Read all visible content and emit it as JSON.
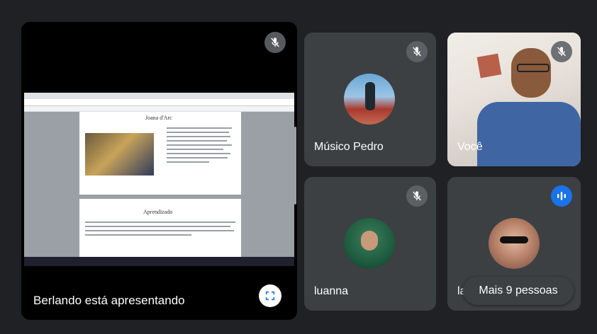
{
  "presenter": {
    "label": "Berlando está apresentando"
  },
  "shared_screen": {
    "doc_heading": "Joana d'Arc",
    "section_heading": "Aprendizado"
  },
  "participants": [
    {
      "name": "Músico Pedro",
      "muted": true
    },
    {
      "name": "Você",
      "muted": true
    },
    {
      "name": "luanna",
      "muted": true
    },
    {
      "name": "la",
      "speaking": true
    }
  ],
  "overflow": {
    "label": "Mais 9 pessoas"
  },
  "icons": {
    "mic_off": "mic-off-icon",
    "fullscreen": "fullscreen-icon",
    "speaking": "audio-wave-icon"
  }
}
